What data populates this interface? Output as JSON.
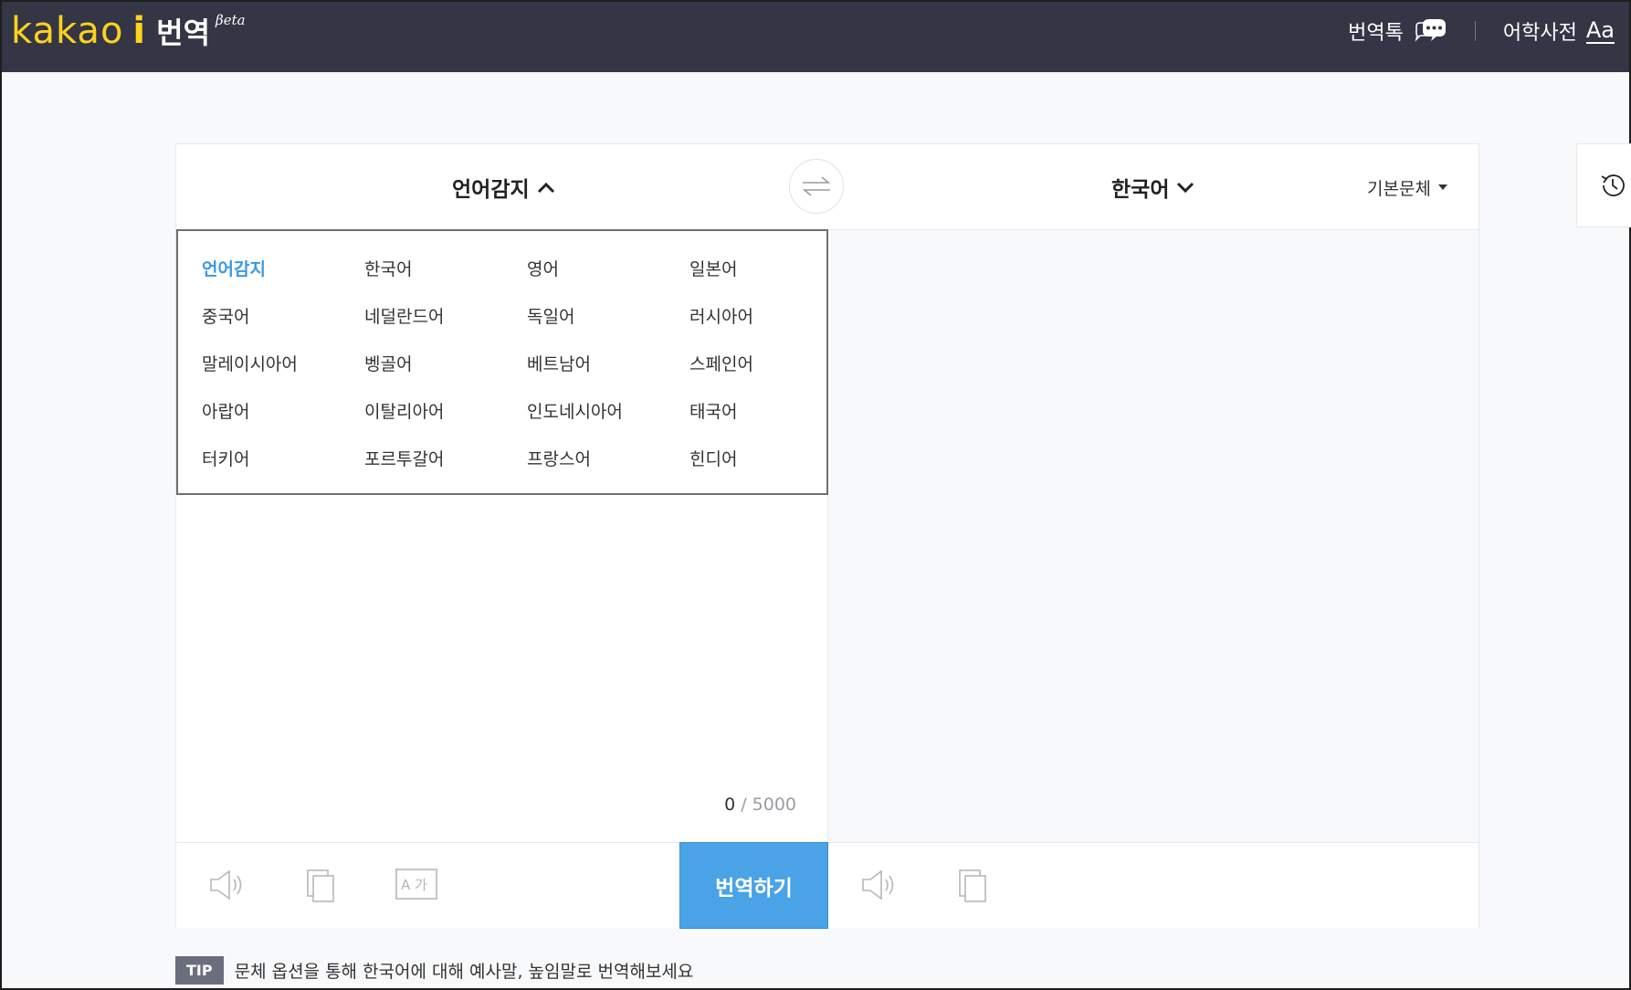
{
  "header": {
    "logo_kakao": "kakao",
    "logo_i": "i",
    "logo_title": "번역",
    "logo_beta": "βeta",
    "nav_chat": "번역톡",
    "nav_dict": "어학사전",
    "dict_icon_text": "Aa"
  },
  "translator": {
    "source_lang": "언어감지",
    "target_lang": "한국어",
    "style": "기본문체",
    "char_count": "0",
    "char_max": "/ 5000",
    "translate_label": "번역하기",
    "font_toggle_label": "A 가"
  },
  "dropdown": {
    "languages": [
      "언어감지",
      "한국어",
      "영어",
      "일본어",
      "중국어",
      "네덜란드어",
      "독일어",
      "러시아어",
      "말레이시아어",
      "벵골어",
      "베트남어",
      "스페인어",
      "아랍어",
      "이탈리아어",
      "인도네시아어",
      "태국어",
      "터키어",
      "포르투갈어",
      "프랑스어",
      "힌디어"
    ],
    "selected": "언어감지"
  },
  "tip": {
    "badge": "TIP",
    "text": "문체 옵션을 통해 한국어에 대해 예사말, 높임말로 번역해보세요"
  },
  "colors": {
    "header_bg": "#343545",
    "logo_yellow": "#ffd21e",
    "accent_blue": "#4aa3e6",
    "active_lang": "#3b98e0"
  }
}
